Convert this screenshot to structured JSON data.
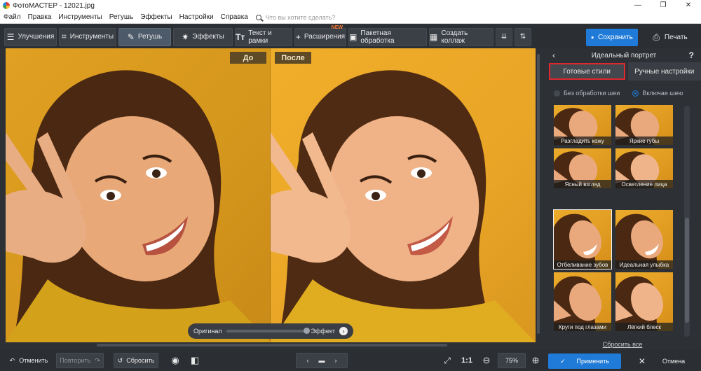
{
  "window": {
    "title": "ФотоМАСТЕР - 12021.jpg",
    "controls": [
      "—",
      "❐",
      "✕"
    ]
  },
  "menu": {
    "items": [
      "Файл",
      "Правка",
      "Инструменты",
      "Ретушь",
      "Эффекты",
      "Настройки",
      "Справка"
    ],
    "search_placeholder": "Что вы хотите сделать?"
  },
  "toolbar": {
    "tabs": [
      {
        "label": "Улучшения",
        "icon": "sliders-icon"
      },
      {
        "label": "Инструменты",
        "icon": "crop-icon"
      },
      {
        "label": "Ретушь",
        "icon": "brush-icon"
      },
      {
        "label": "Эффекты",
        "icon": "sparkle-icon"
      },
      {
        "label": "Текст и рамки",
        "icon": "text-icon"
      },
      {
        "label": "Расширения",
        "icon": "plus-icon",
        "badge": "NEW"
      },
      {
        "label": "Пакетная обработка",
        "icon": "batch-icon"
      },
      {
        "label": "Создать коллаж",
        "icon": "collage-icon"
      }
    ],
    "save_label": "Сохранить",
    "print_label": "Печать"
  },
  "canvas": {
    "before_label": "До",
    "after_label": "После",
    "slider_left": "Оригинал",
    "slider_right": "Эффект"
  },
  "panel": {
    "title": "Идеальный портрет",
    "help": "?",
    "tabs": [
      "Готовые стили",
      "Ручные настройки"
    ],
    "radios": [
      "Без обработки шеи",
      "Включая шею"
    ],
    "styles": [
      "Разгладить кожу",
      "Яркие губы",
      "Ясный взгляд",
      "Осветление лица",
      "Отбеливание зубов",
      "Идеальная улыбка",
      "Круги под глазами",
      "Лёгкий блеск"
    ],
    "reset_all": "Сбросить все"
  },
  "bottom": {
    "undo": "Отменить",
    "redo": "Повторить",
    "reset": "Сбросить",
    "ratio": "1:1",
    "zoom": "75%",
    "apply": "Применить",
    "cancel": "Отмена"
  },
  "colors": {
    "accent": "#1f7ad8",
    "highlight": "#e0272e",
    "background": "#2d3035",
    "photo": "#e6a326"
  }
}
